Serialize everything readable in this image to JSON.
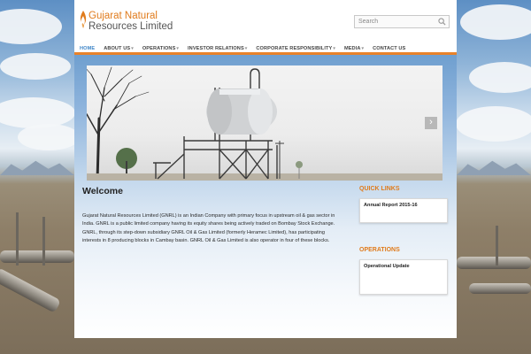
{
  "site": {
    "logo_line1": "Gujarat Natural",
    "logo_line2": "Resources Limited"
  },
  "search": {
    "placeholder": "Search"
  },
  "nav": {
    "items": [
      {
        "label": "HOME",
        "has_dropdown": false,
        "active": true
      },
      {
        "label": "ABOUT US",
        "has_dropdown": true,
        "active": false
      },
      {
        "label": "OPERATIONS",
        "has_dropdown": true,
        "active": false
      },
      {
        "label": "INVESTOR RELATIONS",
        "has_dropdown": true,
        "active": false
      },
      {
        "label": "CORPORATE RESPONSIBILITY",
        "has_dropdown": true,
        "active": false
      },
      {
        "label": "MEDIA",
        "has_dropdown": true,
        "active": false
      },
      {
        "label": "CONTACT US",
        "has_dropdown": false,
        "active": false
      }
    ],
    "caret": "▾"
  },
  "slider": {
    "next_label": "›"
  },
  "main": {
    "title": "Welcome",
    "body": "Gujarat Natural Resources Limited (GNRL) is an Indian Company with primary focus in upstream oil & gas sector in India. GNRL is a public limited company having its equity shares being actively traded on Bombay Stock Exchange. GNRL, through its step-down subsidiary GNRL Oil & Gas Limited (formerly Heramec Limited), has participating interests in 8 producing blocks in Cambay basin. GNRL Oil & Gas Limited is also operator in four of these blocks."
  },
  "sidebar": {
    "quick_links_heading": "QUICK LINKS",
    "quick_links_item": "Annual Report 2015-16",
    "operations_heading": "OPERATIONS",
    "operations_item": "Operational Update"
  },
  "colors": {
    "accent": "#e07b1c",
    "nav_active": "#3f86c8"
  },
  "icons": [
    "flame-logo-icon",
    "search-icon",
    "chevron-right-icon",
    "dropdown-caret-icon"
  ]
}
